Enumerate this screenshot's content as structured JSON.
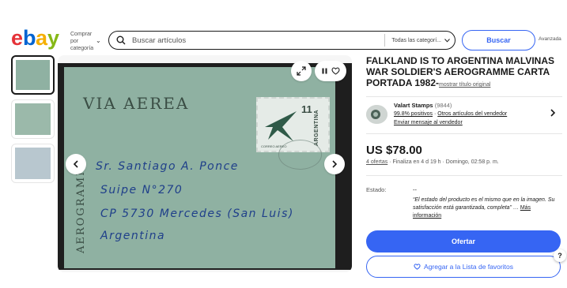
{
  "header": {
    "logo_letters": [
      "e",
      "b",
      "a",
      "y"
    ],
    "shop_by_category": [
      "Comprar",
      "por",
      "categoría"
    ],
    "search_placeholder": "Buscar artículos",
    "category_select": "Todas las categorí...",
    "search_button": "Buscar",
    "advanced": "Avanzada",
    "colors": {
      "e": "#e53238",
      "b": "#0064d2",
      "a": "#f5af02",
      "y": "#86b817",
      "accent": "#3665f3"
    }
  },
  "gallery": {
    "image": {
      "via_aerea": "VIA AEREA",
      "aerogramme": "AEROGRAMME",
      "stamp": {
        "value": "11",
        "country": "ARGENTINA",
        "label": "CORREO AEREO"
      },
      "address_lines": [
        "Sr. Santiago A. Ponce",
        "Suipe N°270",
        "CP 5730 Mercedes (San Luis)",
        "Argentina"
      ]
    },
    "thumbnails": 3,
    "icons": [
      "expand-icon",
      "pause-icon",
      "heart-icon",
      "prev-arrow-icon",
      "next-arrow-icon"
    ]
  },
  "item": {
    "title": "FALKLAND IS TO ARGENTINA MALVINAS WAR SOLDIER'S AEROGRAMME CARTA PORTADA 1982-",
    "show_original": "mostrar título original",
    "seller": {
      "name": "Valart Stamps",
      "count": "(9844)",
      "positive": "99.8% positivos",
      "other_items": "Otros artículos del vendedor",
      "message": "Enviar mensaje al vendedor"
    },
    "price": "US $78.00",
    "offers": "4 ofertas",
    "ending": "· Finaliza en 4 d 19 h · Domingo, 02:58 p. m.",
    "condition_label": "Estado:",
    "condition_value": "--",
    "condition_desc": "“El estado del producto es el mismo que en la imagen. Su satisfacción está garantizada, completa” …",
    "more_info": "Más información",
    "offer_button": "Ofertar",
    "watchlist_button": "Agregar a la Lista de favoritos",
    "help": "?"
  }
}
